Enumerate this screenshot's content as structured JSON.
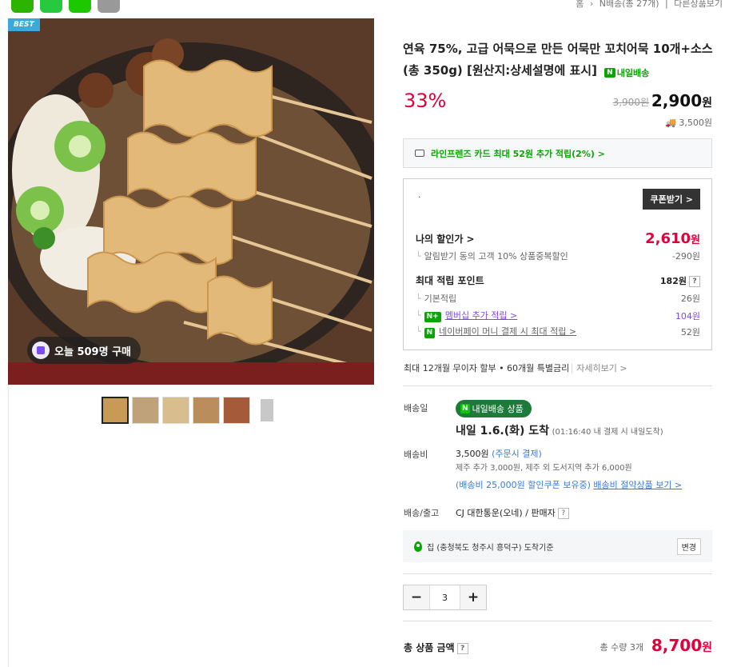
{
  "breadcrumb": {
    "home": "홈",
    "category": "N배송(총 27개)",
    "other": "다른상품보기"
  },
  "badge": "BEST",
  "purchase_badge": "오늘 509명 구매",
  "title": "연육 75%, 고급 어묵으로 만든 어묵만 꼬치어묵 10개+소스 (총 350g) [원산지:상세설명에 표시]",
  "delivery_badge": "내일배송",
  "discount": "33%",
  "original_price": "3,900원",
  "price": "2,900",
  "price_unit": "원",
  "shipping_fee_top": "3,500원",
  "card_promo": "라인프렌즈 카드 최대 52원 추가 적립(2%) >",
  "coupon_button": "쿠폰받기 >",
  "my_price_label": "나의 할인가 >",
  "my_price": "2,610",
  "alarm_discount_label": "알림받기 동의 고객 10% 상품중복할인",
  "alarm_discount_value": "-290원",
  "points_label": "최대 적립 포인트",
  "points_value": "182원",
  "basic_points_label": "기본적립",
  "basic_points_value": "26원",
  "membership_label": "멤버십 추가 적립 >",
  "membership_value": "104원",
  "naverpay_label": "네이버페이 머니 결제 시 최대 적립 >",
  "naverpay_value": "52원",
  "installment": "최대 12개월 무이자 할부 • 60개월 특별금리",
  "installment_link": "자세히보기 >",
  "delivery_date_label": "배송일",
  "delivery_pill": "내일배송 상품",
  "delivery_date": "내일 1.6.(화) 도착",
  "delivery_date_note": "(01:16:40 내 결제 시 내일도착)",
  "shipping_label": "배송비",
  "shipping_value": "3,500원",
  "shipping_paytype": "(주문시 결제)",
  "shipping_extra": "제주 추가 3,000원, 제주 외 도서지역 추가 6,000원",
  "shipping_coupon": "(배송비 25,000원 할인쿠폰 보유중)",
  "shipping_save_link": "배송비 절약상품 보기 >",
  "carrier_label": "배송/출고",
  "carrier_value": "CJ 대한통운(오네) / 판매자",
  "address": "집 (충청북도 청주시 흥덕구) 도착기준",
  "address_change": "변경",
  "quantity": "3",
  "qty_minus": "−",
  "qty_plus": "+",
  "total_label": "총 상품 금액",
  "total_count": "총 수량 3개",
  "total_price": "8,700",
  "total_unit": "원"
}
